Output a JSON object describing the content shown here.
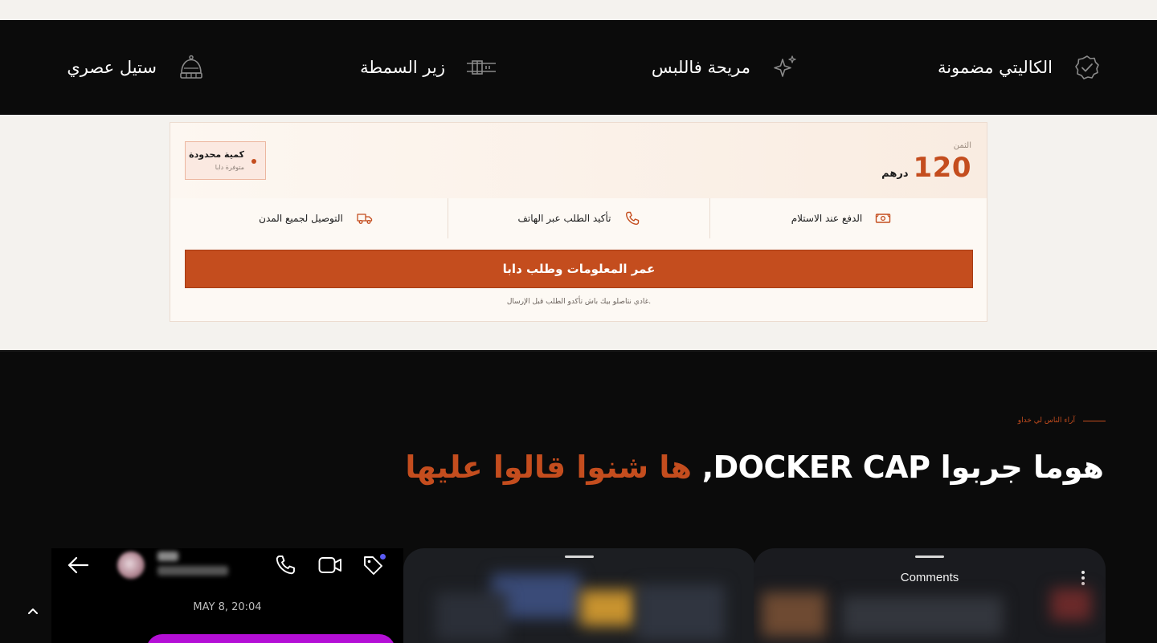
{
  "features": {
    "quality": "الكاليتي مضمونة",
    "comfort": "مريحة فاللبس",
    "strap": "زير السمطة",
    "style": "ستيل عصري"
  },
  "order": {
    "price_label": "الثمن",
    "price_value": "120",
    "currency": "درهم",
    "limited_title": "كمية محدودة",
    "limited_sub": "متوفرة دابا",
    "info": {
      "cod": "الدفع عند الاستلام",
      "phone_confirm": "تأكيد الطلب عبر الهاتف",
      "delivery": "التوصيل لجميع المدن"
    },
    "button_label": "عمر المعلومات وطلب دابا",
    "button_note": "غادي نتاصلو بيك باش تأكدو الطلب قبل الإرسال."
  },
  "reviews": {
    "eyebrow": "آراء الناس لي خداو",
    "headline_main": "هوما جربوا DOCKER CAP,",
    "headline_accent": " ها شنوا قالوا عليها",
    "screenshots": {
      "chat_timestamp": "MAY 8, 20:04",
      "comments_title": "Comments"
    }
  },
  "colors": {
    "accent": "#c44d1e",
    "dark": "#0b0b0b",
    "cream": "#f4f2ee"
  }
}
